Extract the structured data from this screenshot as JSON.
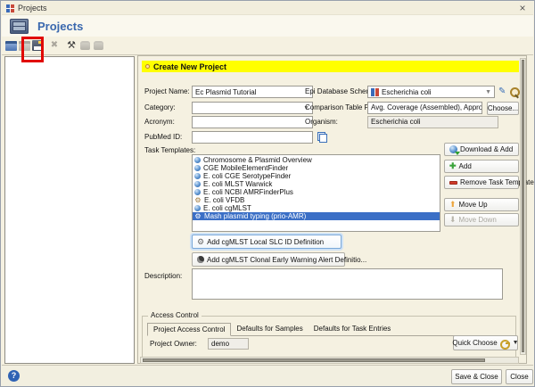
{
  "window": {
    "title": "Projects",
    "close_glyph": "×"
  },
  "header": {
    "title": "Projects"
  },
  "annotation": {
    "color": "#e10600"
  },
  "toolbar": {
    "icons": [
      {
        "name": "new-project-icon",
        "kind": "folder",
        "enabled": true
      },
      {
        "name": "open-project-icon",
        "kind": "folder-off",
        "enabled": false
      },
      {
        "name": "save-project-icon",
        "kind": "save",
        "enabled": true,
        "highlighted": true
      },
      {
        "name": "delete-project-icon",
        "kind": "x",
        "glyph": "✖",
        "enabled": false
      },
      {
        "name": "project-tools-icon",
        "kind": "tools",
        "glyph": "⚒",
        "enabled": true
      },
      {
        "name": "grant-access-icon",
        "kind": "hand",
        "enabled": false
      },
      {
        "name": "revoke-access-icon",
        "kind": "hand",
        "enabled": false
      }
    ]
  },
  "form": {
    "section_title": "Create New Project",
    "project_name": {
      "label": "Project Name:",
      "value": "Ec Plasmid Tutorial"
    },
    "category": {
      "label": "Category:",
      "value": ""
    },
    "acronym": {
      "label": "Acronym:",
      "value": ""
    },
    "pubmed": {
      "label": "PubMed ID:",
      "value": ""
    },
    "epi_scheme": {
      "label": "Epi Database Scheme:",
      "value": "Escherichia coli"
    },
    "comparison_fields": {
      "label": "Comparison Table Fields:",
      "value": "Avg. Coverage (Assembled), Approximated Ger",
      "choose_label": "Choose..."
    },
    "organism": {
      "label": "Organism:",
      "value": "Escherichia coli"
    },
    "task_templates": {
      "label": "Task Templates:",
      "items": [
        {
          "label": "Chromosome & Plasmid Overview",
          "icon": "globe",
          "selected": false
        },
        {
          "label": "CGE MobileElementFinder",
          "icon": "globe",
          "selected": false
        },
        {
          "label": "E. coli CGE SerotypeFinder",
          "icon": "globe",
          "selected": false
        },
        {
          "label": "E. coli MLST Warwick",
          "icon": "globe",
          "selected": false
        },
        {
          "label": "E. coli NCBI AMRFinderPlus",
          "icon": "globe",
          "selected": false
        },
        {
          "label": "E. coli VFDB",
          "icon": "gear",
          "selected": false
        },
        {
          "label": "E. coli cgMLST",
          "icon": "globe",
          "selected": false
        },
        {
          "label": "Mash plasmid typing (prio-AMR)",
          "icon": "gear",
          "selected": true
        }
      ]
    },
    "side_buttons": [
      {
        "name": "download-add-button",
        "icon": "globe-download",
        "label": "Download & Add",
        "enabled": true
      },
      {
        "name": "add-button",
        "icon": "plus",
        "label": "Add",
        "enabled": true
      },
      {
        "name": "remove-task-template-button",
        "icon": "minus",
        "label": "Remove Task Template",
        "enabled": true
      },
      {
        "name": "move-up-button",
        "icon": "arrow-up",
        "label": "Move Up",
        "enabled": true
      },
      {
        "name": "move-down-button",
        "icon": "arrow-down",
        "label": "Move Down",
        "enabled": false
      }
    ],
    "cgmlst_buttons": [
      "Add cgMLST Local SLC ID Definition",
      "Add cgMLST Clonal Early Warning Alert Definitio..."
    ],
    "description": {
      "label": "Description:",
      "value": ""
    }
  },
  "access_control": {
    "legend": "Access Control",
    "tabs": [
      "Project Access Control",
      "Defaults for Samples",
      "Defaults for Task Entries"
    ],
    "active_tab": 0,
    "project_owner": {
      "label": "Project Owner:",
      "value": "demo"
    },
    "quick_choose_label": "Quick Choose"
  },
  "footer": {
    "save_close_label": "Save & Close",
    "close_label": "Close"
  }
}
